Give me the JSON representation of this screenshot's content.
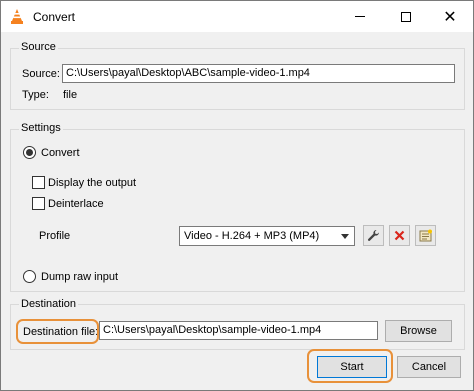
{
  "window": {
    "title": "Convert"
  },
  "source": {
    "group_label": "Source",
    "source_label": "Source:",
    "source_value": "C:\\Users\\payal\\Desktop\\ABC\\sample-video-1.mp4",
    "type_label": "Type:",
    "type_value": "file"
  },
  "settings": {
    "group_label": "Settings",
    "convert_label": "Convert",
    "convert_selected": true,
    "display_output_label": "Display the output",
    "display_output_checked": false,
    "deinterlace_label": "Deinterlace",
    "deinterlace_checked": false,
    "profile_label": "Profile",
    "profile_value": "Video - H.264 + MP3 (MP4)",
    "dump_raw_label": "Dump raw input",
    "dump_raw_selected": false
  },
  "destination": {
    "group_label": "Destination",
    "file_label": "Destination file:",
    "file_value": "C:\\Users\\payal\\Desktop\\sample-video-1.mp4",
    "browse_label": "Browse"
  },
  "footer": {
    "start_label": "Start",
    "cancel_label": "Cancel"
  },
  "colors": {
    "highlight": "#e8913a",
    "delete_icon": "#d9261c"
  },
  "icons": [
    "vlc-cone-icon",
    "minimize-icon",
    "maximize-icon",
    "close-icon",
    "wrench-icon",
    "delete-x-icon",
    "new-profile-icon",
    "dropdown-arrow-icon"
  ]
}
